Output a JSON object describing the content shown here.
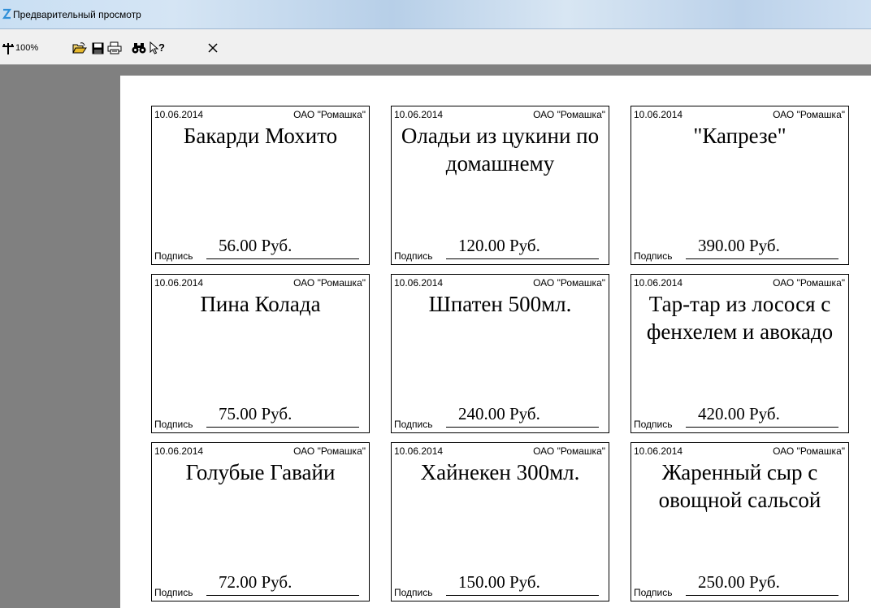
{
  "window": {
    "title": "Предварительный просмотр"
  },
  "toolbar": {
    "zoom_label": "100%",
    "buttons": [
      "zoom-icon",
      "open-folder-icon",
      "save-icon",
      "print-icon",
      "find-icon",
      "help-pointer-icon",
      "close-icon"
    ]
  },
  "cards": [
    {
      "date": "10.06.2014",
      "company": "ОАО \"Ромашка\"",
      "name": "Бакарди Мохито",
      "price": "56.00 Руб.",
      "sign": "Подпись"
    },
    {
      "date": "10.06.2014",
      "company": "ОАО \"Ромашка\"",
      "name": "Оладьи из цукини по домашнему",
      "price": "120.00 Руб.",
      "sign": "Подпись"
    },
    {
      "date": "10.06.2014",
      "company": "ОАО \"Ромашка\"",
      "name": "\"Капрезе\"",
      "price": "390.00 Руб.",
      "sign": "Подпись"
    },
    {
      "date": "10.06.2014",
      "company": "ОАО \"Ромашка\"",
      "name": "Пина Колада",
      "price": "75.00 Руб.",
      "sign": "Подпись"
    },
    {
      "date": "10.06.2014",
      "company": "ОАО \"Ромашка\"",
      "name": "Шпатен 500мл.",
      "price": "240.00 Руб.",
      "sign": "Подпись"
    },
    {
      "date": "10.06.2014",
      "company": "ОАО \"Ромашка\"",
      "name": "Тар-тар из лосося с фенхелем и авокадо",
      "price": "420.00 Руб.",
      "sign": "Подпись"
    },
    {
      "date": "10.06.2014",
      "company": "ОАО \"Ромашка\"",
      "name": "Голубые Гавайи",
      "price": "72.00 Руб.",
      "sign": "Подпись"
    },
    {
      "date": "10.06.2014",
      "company": "ОАО \"Ромашка\"",
      "name": "Хайнекен 300мл.",
      "price": "150.00 Руб.",
      "sign": "Подпись"
    },
    {
      "date": "10.06.2014",
      "company": "ОАО \"Ромашка\"",
      "name": "Жаренный сыр с овощной сальсой",
      "price": "250.00 Руб.",
      "sign": "Подпись"
    }
  ]
}
